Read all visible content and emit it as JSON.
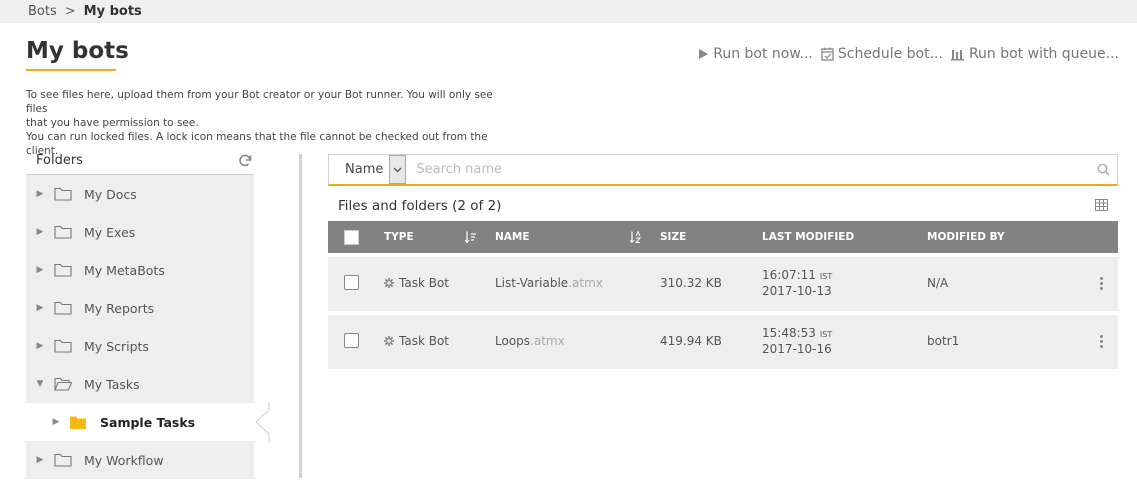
{
  "breadcrumb": {
    "parent": "Bots",
    "separator": ">",
    "current": "My bots"
  },
  "page_title": "My bots",
  "actions": {
    "run_now": "Run bot now...",
    "schedule": "Schedule bot...",
    "run_queue": "Run bot with queue..."
  },
  "description": {
    "line1": "To see files here, upload them from your Bot creator or your Bot runner. You will only see files",
    "line2": "that you have permission to see.",
    "line3": "You can run locked files. A lock icon means that the file cannot be checked out from the client."
  },
  "folders": {
    "header": "Folders",
    "items": [
      {
        "label": "My Docs"
      },
      {
        "label": "My Exes"
      },
      {
        "label": "My MetaBots"
      },
      {
        "label": "My Reports"
      },
      {
        "label": "My Scripts"
      },
      {
        "label": "My Tasks"
      },
      {
        "label": "Sample Tasks"
      },
      {
        "label": "My Workflow"
      }
    ]
  },
  "search": {
    "field": "Name",
    "placeholder": "Search name"
  },
  "files": {
    "heading": "Files and folders (2 of 2)",
    "columns": {
      "type": "TYPE",
      "name": "NAME",
      "size": "SIZE",
      "last_modified": "LAST MODIFIED",
      "modified_by": "MODIFIED BY"
    },
    "rows": [
      {
        "type": "Task Bot",
        "name": "List-Variable",
        "ext": ".atmx",
        "size": "310.32 KB",
        "time": "16:07:11",
        "tz": "IST",
        "date": "2017-10-13",
        "modified_by": "N/A"
      },
      {
        "type": "Task Bot",
        "name": "Loops",
        "ext": ".atmx",
        "size": "419.94 KB",
        "time": "15:48:53",
        "tz": "IST",
        "date": "2017-10-16",
        "modified_by": "botr1"
      }
    ]
  },
  "colors": {
    "accent": "#f2a91c",
    "header_gray": "#828282",
    "panel_gray": "#eeeeee"
  }
}
